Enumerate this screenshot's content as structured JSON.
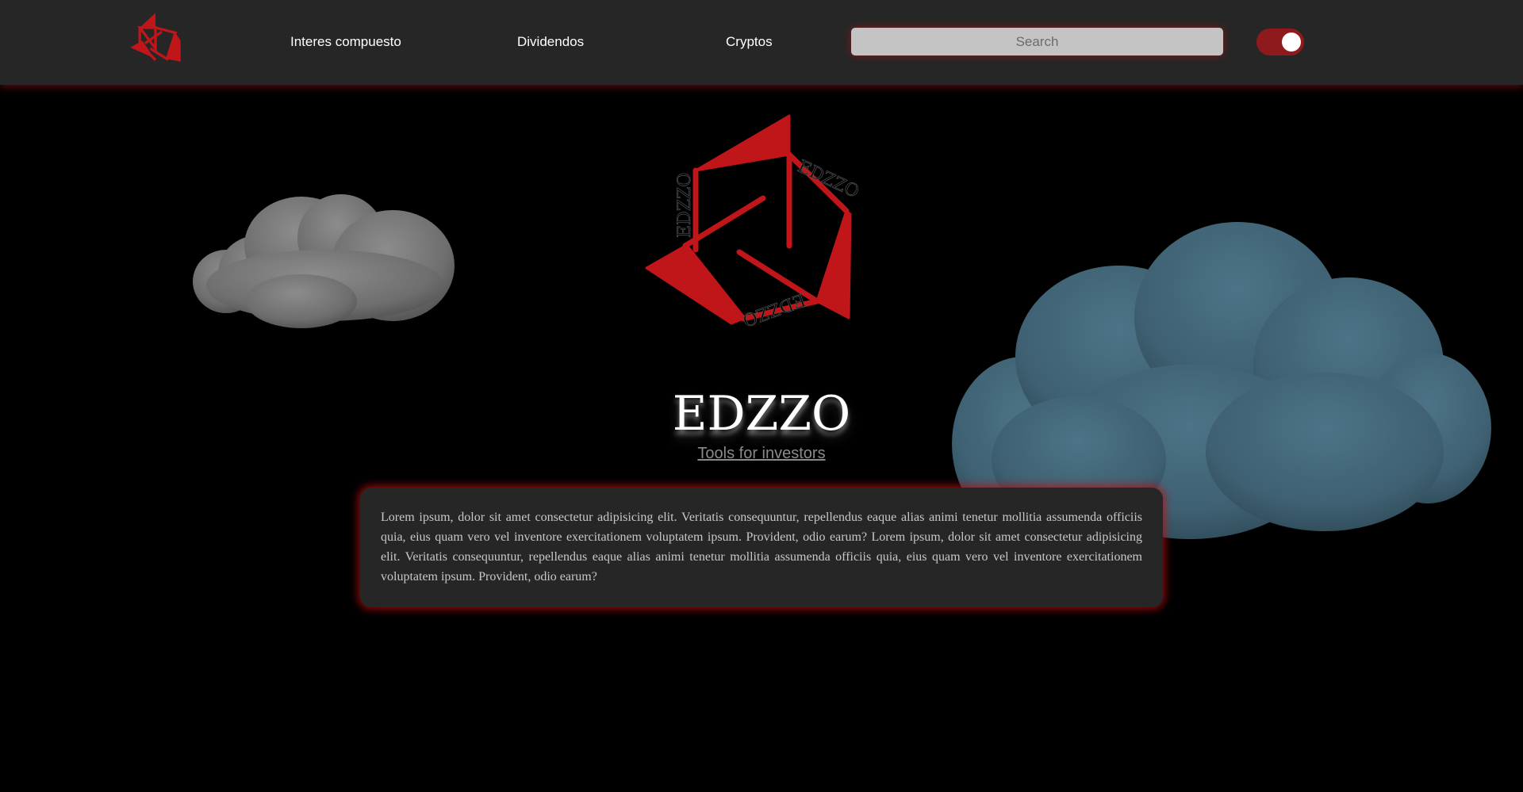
{
  "nav": {
    "logo_icon": "edzzo-logo-icon",
    "links": [
      {
        "label": "Interes compuesto"
      },
      {
        "label": "Dividendos"
      },
      {
        "label": "Cryptos"
      }
    ],
    "search": {
      "placeholder": "Search",
      "value": ""
    },
    "theme_toggle": {
      "state": "on"
    }
  },
  "hero": {
    "logo_text": "EDZZO",
    "title": "EDZZO",
    "subtitle": "Tools for investors"
  },
  "card": {
    "text": "Lorem ipsum, dolor sit amet consectetur adipisicing elit. Veritatis consequuntur, repellendus eaque alias animi tenetur mollitia assumenda officiis quia, eius quam vero vel inventore exercitationem voluptatem ipsum. Provident, odio earum? Lorem ipsum, dolor sit amet consectetur adipisicing elit. Veritatis consequuntur, repellendus eaque alias animi tenetur mollitia assumenda officiis quia, eius quam vero vel inventore exercitationem voluptatem ipsum. Provident, odio earum?"
  },
  "colors": {
    "accent": "#c0161a",
    "navbar_bg": "#262626",
    "page_bg": "#000000",
    "toggle_bg": "#8e1a1e",
    "cloud_left": "#7a7a7a",
    "cloud_right": "#3f6272"
  }
}
